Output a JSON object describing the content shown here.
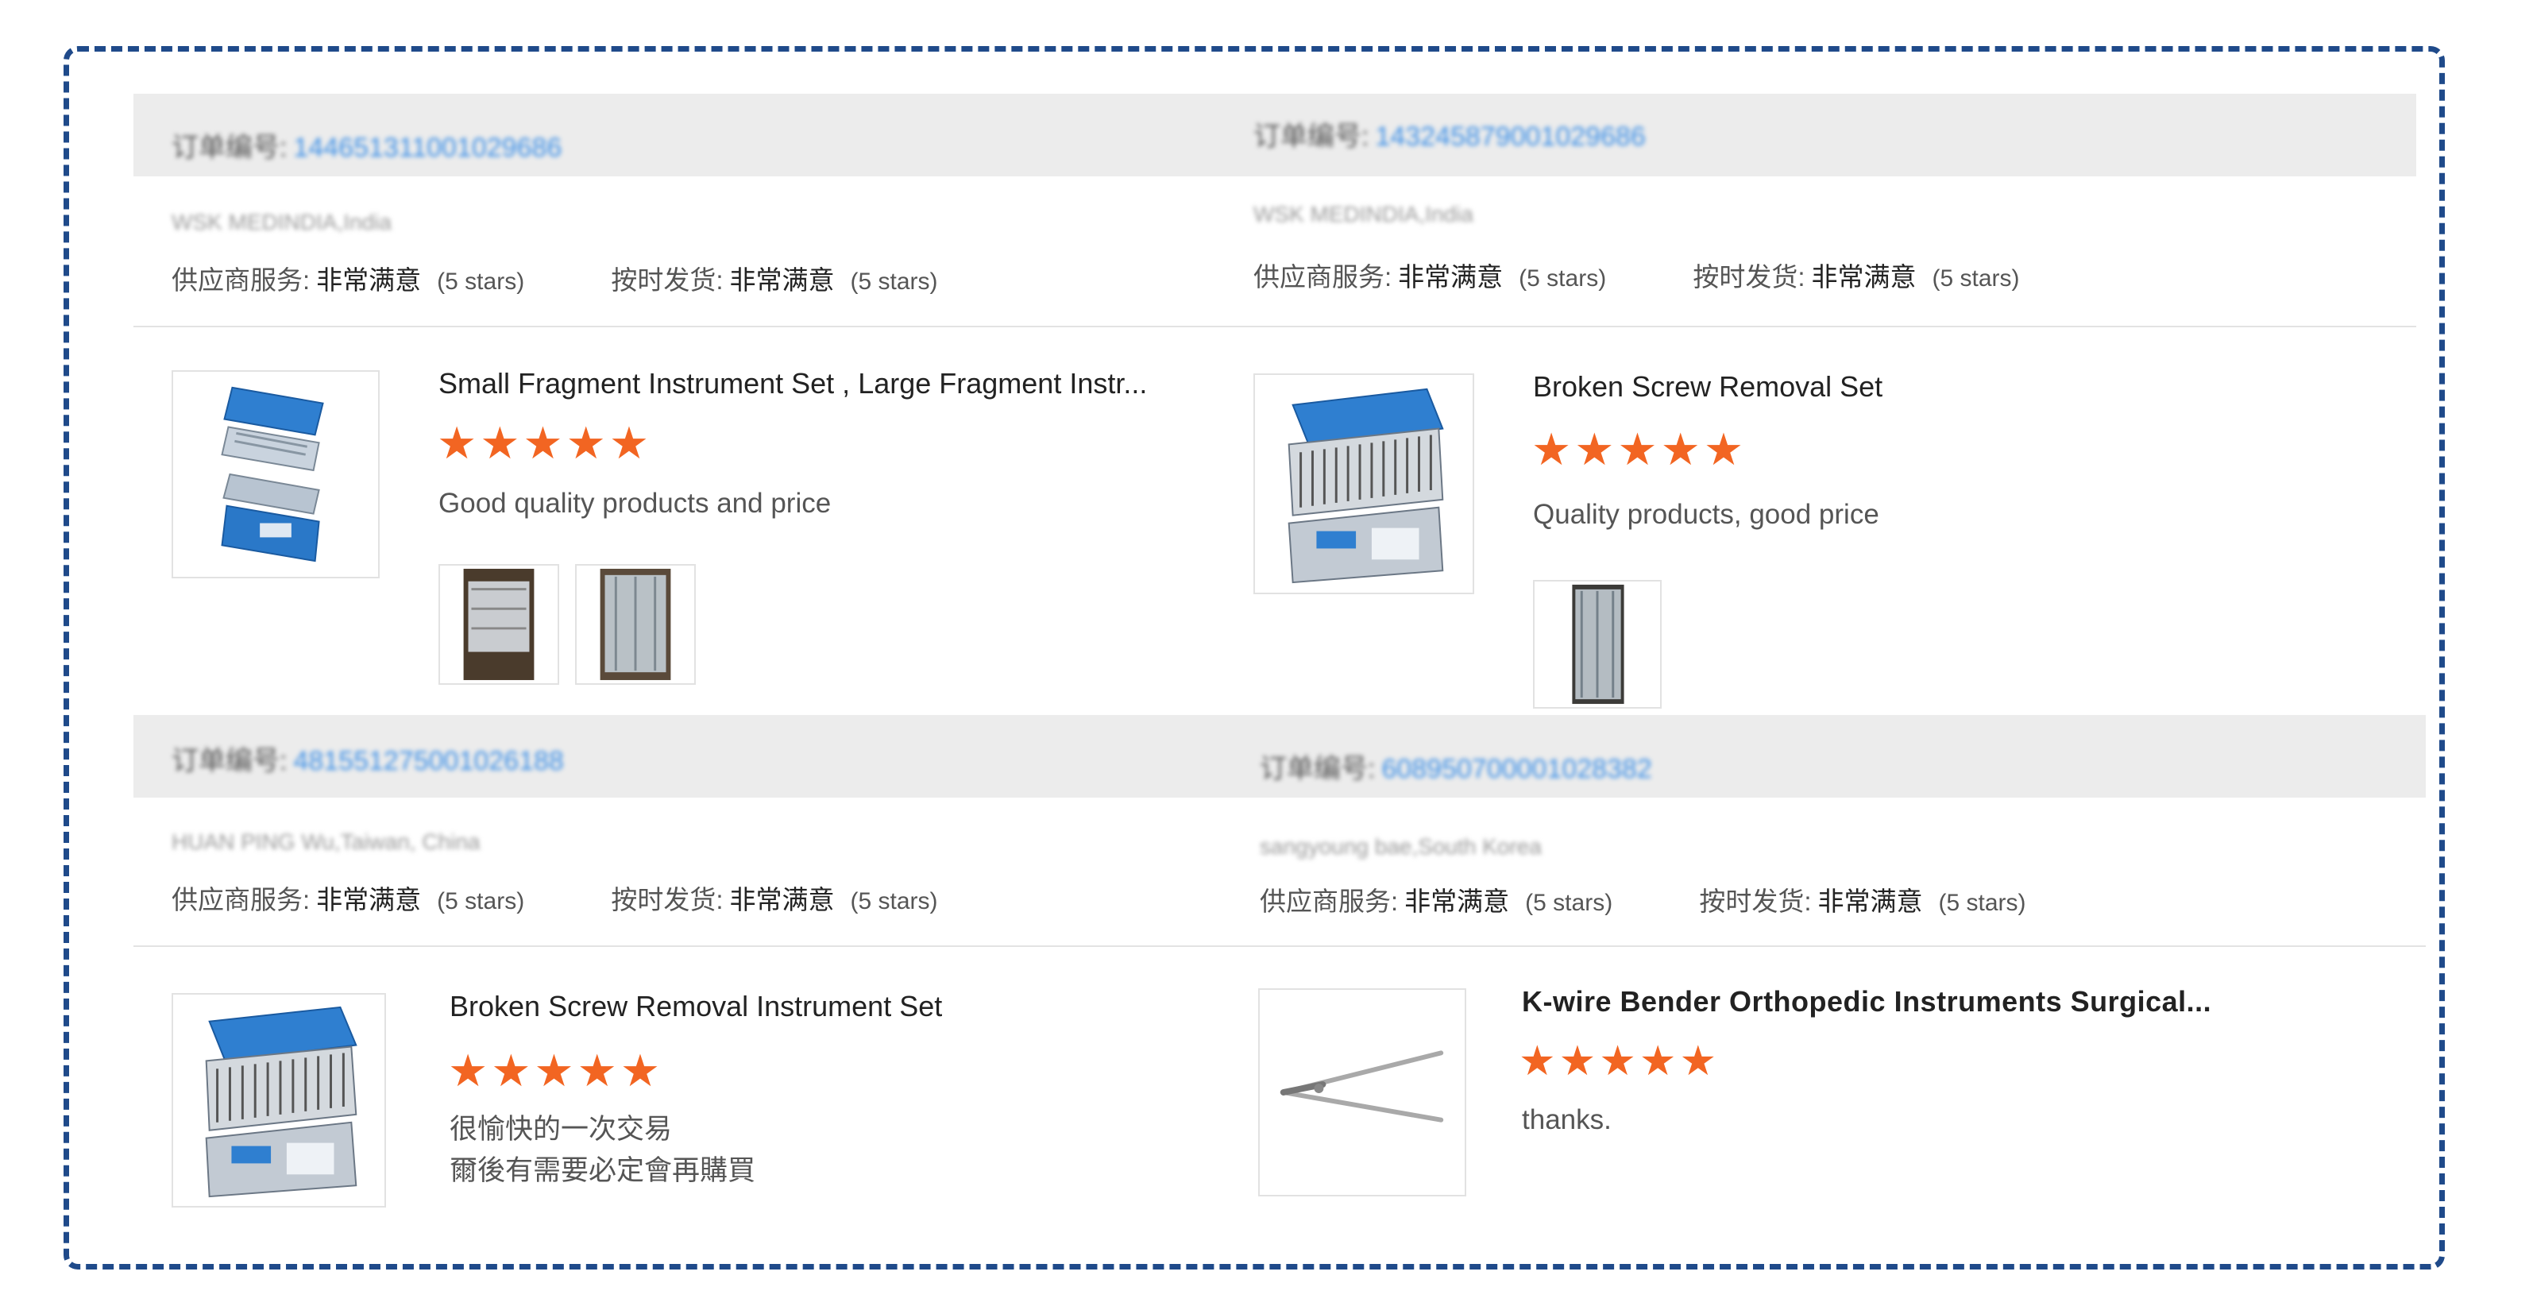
{
  "labels": {
    "order_no": "订单编号:",
    "supplier_service": "供应商服务:",
    "on_time_delivery": "按时发货:",
    "rating_value": "非常满意",
    "rating_stars": "(5 stars)"
  },
  "reviews": [
    {
      "order_number": "144651311001029686",
      "buyer": "WSK MEDINDIA,India",
      "product_title": "Small Fragment Instrument Set , Large Fragment Instr...",
      "product_icon": "instrument-case-icon",
      "rating": 5,
      "comment": [
        "Good quality products and price"
      ],
      "photos": 2
    },
    {
      "order_number": "143245879001029686",
      "buyer": "WSK MEDINDIA,India",
      "product_title": "Broken Screw Removal Set",
      "product_icon": "instrument-tray-icon",
      "rating": 5,
      "comment": [
        "Quality products, good price"
      ],
      "photos": 1
    },
    {
      "order_number": "481551275001026188",
      "buyer": "HUAN PING Wu,Taiwan, China",
      "product_title": "Broken Screw Removal Instrument Set",
      "product_icon": "instrument-tray-icon",
      "rating": 5,
      "comment": [
        "很愉快的一次交易",
        "爾後有需要必定會再購買"
      ],
      "photos": 0
    },
    {
      "order_number": "608950700001028382",
      "buyer": "sangyoung bae,South Korea",
      "product_title": "K-wire Bender Orthopedic Instruments Surgical...",
      "product_icon": "wire-bender-icon",
      "rating": 5,
      "comment": [
        "thanks."
      ],
      "photos": 0
    }
  ],
  "colors": {
    "star": "#f26522",
    "order_number": "#3a8ee6",
    "frame_border": "#1f4a8a",
    "header_bg": "#ececec"
  }
}
